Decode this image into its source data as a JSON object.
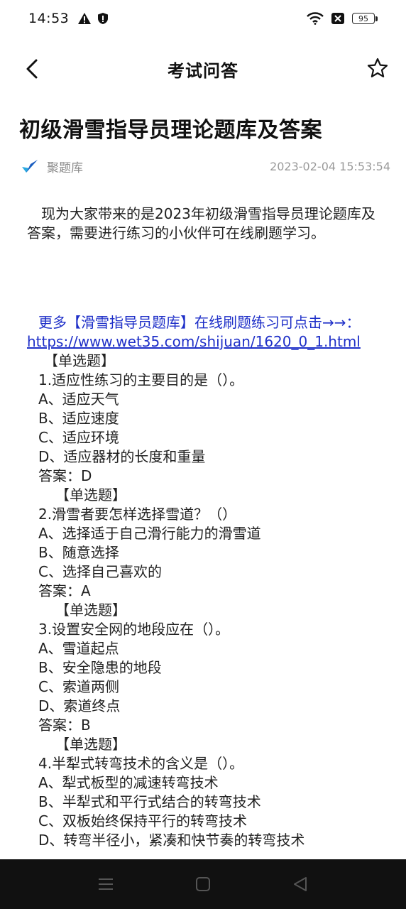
{
  "status_bar": {
    "time": "14:53",
    "battery": "95",
    "icons": [
      "warning-icon",
      "shield-icon",
      "wifi-icon",
      "sim-off-icon",
      "battery-icon"
    ]
  },
  "app_bar": {
    "title": "考试问答",
    "back_icon": "chevron-left-icon",
    "favorite_icon": "star-outline-icon"
  },
  "article": {
    "title": "初级滑雪指导员理论题库及答案",
    "source": "聚题库",
    "publish_time": "2023-02-04 15:53:54",
    "intro": "现为大家带来的是2023年初级滑雪指导员理论题库及答案，需要进行练习的小伙伴可在线刷题学习。",
    "promo_text": "更多【滑雪指导员题库】在线刷题练习可点击→→：",
    "promo_link": "https://www.wet35.com/shijuan/1620_0_1.html"
  },
  "questions_lines": [
    {
      "kind": "type",
      "text": "【单选题】"
    },
    {
      "kind": "line",
      "text": "1.适应性练习的主要目的是（）。"
    },
    {
      "kind": "line",
      "text": "A、适应天气"
    },
    {
      "kind": "line",
      "text": "B、适应速度"
    },
    {
      "kind": "line",
      "text": "C、适应环境"
    },
    {
      "kind": "line",
      "text": "D、适应器材的长度和重量"
    },
    {
      "kind": "line",
      "text": "答案：D"
    },
    {
      "kind": "type-deep",
      "text": "【单选题】"
    },
    {
      "kind": "line",
      "text": "2.滑雪者要怎样选择雪道？（）"
    },
    {
      "kind": "line",
      "text": "A、选择适于自己滑行能力的滑雪道"
    },
    {
      "kind": "line",
      "text": "B、随意选择"
    },
    {
      "kind": "line",
      "text": "C、选择自己喜欢的"
    },
    {
      "kind": "line",
      "text": "答案：A"
    },
    {
      "kind": "type-deep",
      "text": "【单选题】"
    },
    {
      "kind": "line",
      "text": "3.设置安全网的地段应在（）。"
    },
    {
      "kind": "line",
      "text": "A、雪道起点"
    },
    {
      "kind": "line",
      "text": "B、安全隐患的地段"
    },
    {
      "kind": "line",
      "text": "C、索道两侧"
    },
    {
      "kind": "line",
      "text": "D、索道终点"
    },
    {
      "kind": "line",
      "text": "答案：B"
    },
    {
      "kind": "type-deep",
      "text": "【单选题】"
    },
    {
      "kind": "line",
      "text": "4.半犁式转弯技术的含义是（）。"
    },
    {
      "kind": "line",
      "text": "A、犁式板型的减速转弯技术"
    },
    {
      "kind": "line",
      "text": "B、半犁式和平行式结合的转弯技术"
    },
    {
      "kind": "line",
      "text": "C、双板始终保持平行的转弯技术"
    },
    {
      "kind": "line",
      "text": "D、转弯半径小，紧凑和快节奏的转弯技术"
    }
  ],
  "nav_bar": {
    "icons": [
      "menu-icon",
      "home-square-icon",
      "back-triangle-icon"
    ]
  },
  "colors": {
    "link": "#1e2fc8",
    "meta": "#8a8a8a",
    "nav_background": "#111111"
  }
}
